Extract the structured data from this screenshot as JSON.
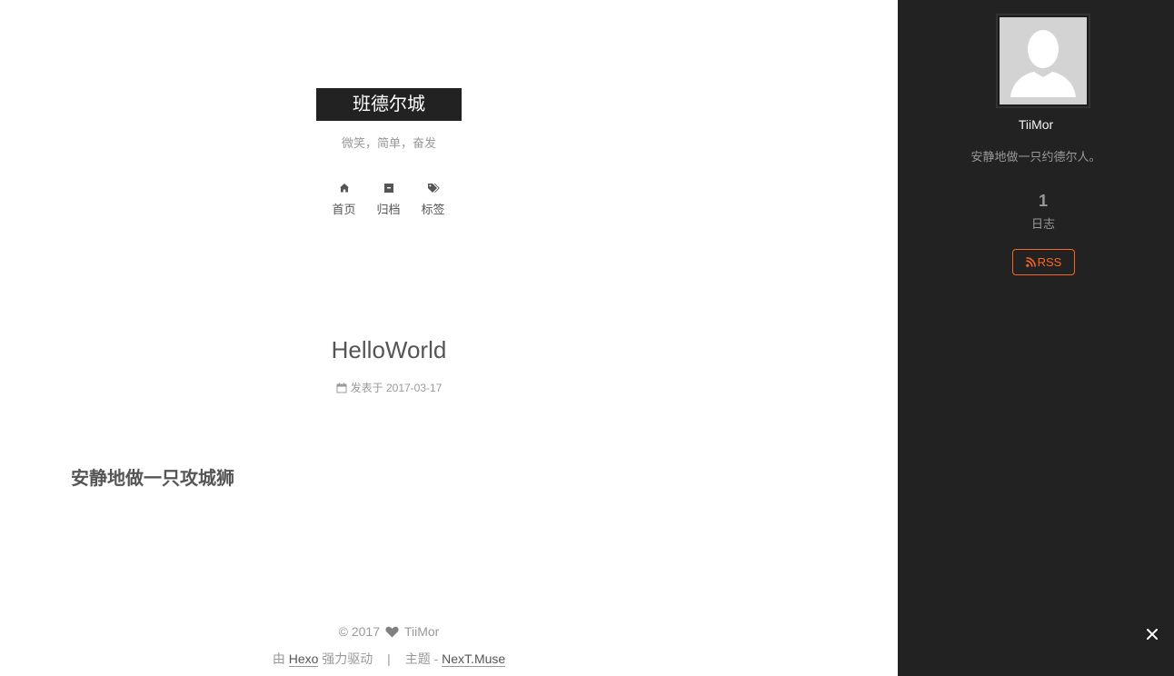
{
  "site": {
    "title": "班德尔城",
    "subtitle": "微笑，简单，奋发"
  },
  "menu": {
    "items": [
      {
        "label": "首页",
        "icon": "home-icon"
      },
      {
        "label": "归档",
        "icon": "archive-icon"
      },
      {
        "label": "标签",
        "icon": "tags-icon"
      }
    ]
  },
  "post": {
    "title": "HelloWorld",
    "meta_prefix": "发表于",
    "date": "2017-03-17",
    "heading": "安静地做一只攻城狮"
  },
  "footer": {
    "copyright": "© 2017",
    "author": "TiiMor",
    "powered_prefix": "由",
    "powered_link": "Hexo",
    "powered_suffix": "强力驱动",
    "separator": "|",
    "theme_prefix": "主题 -",
    "theme_link": "NexT.Muse"
  },
  "sidebar": {
    "author_name": "TiiMor",
    "author_description": "安静地做一只约德尔人。",
    "post_count": "1",
    "post_count_label": "日志",
    "rss_label": "RSS",
    "close_icon": "close-icon",
    "avatar_icon": "default-avatar-icon"
  },
  "colors": {
    "sidebar_bg": "#222222",
    "accent_rss": "#fc6423",
    "brand_bg": "#222222",
    "text": "#555555",
    "muted": "#999999"
  }
}
